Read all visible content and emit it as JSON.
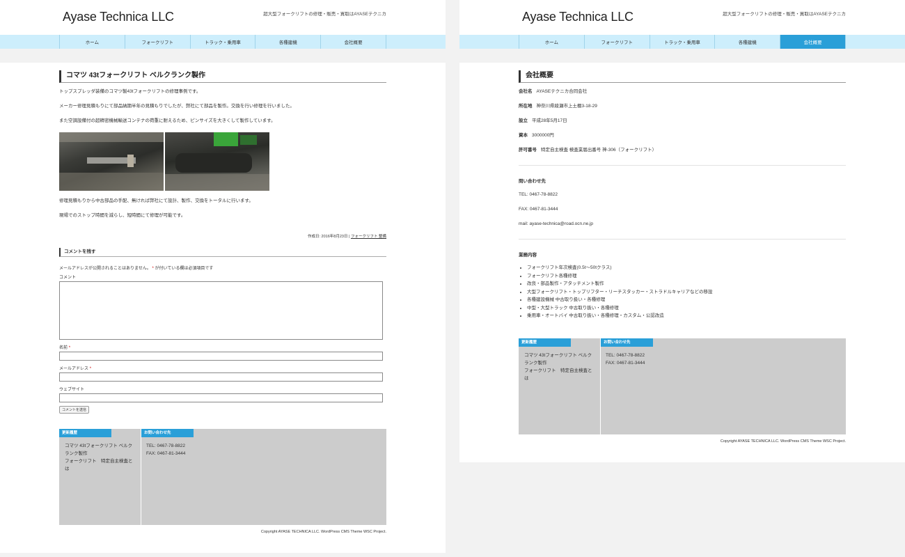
{
  "site": {
    "title": "Ayase Technica LLC",
    "tagline": "超大型フォークリフトの修理・販売・買取はAYASEテクニカ"
  },
  "nav": [
    "ホーム",
    "フォークリフト",
    "トラック・乗用車",
    "各種建機",
    "会社概要"
  ],
  "post": {
    "title": "コマツ 43tフォークリフト ベルクランク製作",
    "p1": "トップスプレッダ装備のコマツ製43tフォークリフトの修理事例です。",
    "p2": "メーカー修理見積もりにて部品納期半年の見積もりでしたが、弊社にて部品を製作。交換を行い修理を行いました。",
    "p3": "また空調設備付の超精密機械輸送コンテナの荷重に耐えるため、ピンサイズを大きくして製作しています。",
    "p4": "修理見積もりから中古部品の手配、無ければ弊社にて設計、製作、交換をトータルに行います。",
    "p5": "現場でのストップ時間を減らし、短時間にて修理が可能です。",
    "meta_prefix": "作成日: 2016年8月23日 |",
    "meta_link": "フォークリフト 整備"
  },
  "comment_form": {
    "heading": "コメントを残す",
    "notice_before": "メールアドレスが公開されることはありません。",
    "notice_star": "*",
    "notice_after": " が付いている欄は必須項目です",
    "comment_label": "コメント",
    "name_label": "名前",
    "email_label": "メールアドレス",
    "website_label": "ウェブサイト",
    "required_mark": "*",
    "submit": "コメントを送信"
  },
  "footer": {
    "updates_tab": "更新履歴",
    "updates": [
      "コマツ 43tフォークリフト ベルク",
      "ランク製作",
      "フォークリフト　特定自主検査と",
      "は"
    ],
    "contact_tab": "お問い合わせ先",
    "tel": "TEL: 0467-78-8822",
    "fax": "FAX: 0467-81-3444",
    "copyright": "Copyright AYASE TECHNICA LLC. WordPress CMS Theme WSC Project."
  },
  "company": {
    "title": "会社概要",
    "rows": [
      {
        "label": "会社名",
        "value": "AYASEテクニカ合同会社"
      },
      {
        "label": "所在地",
        "value": "神奈川県綾瀬市上土棚3-18-29"
      },
      {
        "label": "設立",
        "value": "平成28年5月17日"
      },
      {
        "label": "資本",
        "value": "3000000円"
      },
      {
        "label": "許可番号",
        "value": "特定自主検査 検査業届出番号 神-306（フォークリフト）"
      }
    ],
    "contact_heading": "問い合わせ先",
    "tel": "TEL: 0467-78-8822",
    "fax": "FAX: 0467-81-3444",
    "mail": "mail: ayase-technica@road.ocn.ne.jp",
    "services_heading": "業務内容",
    "services": [
      "フォークリフト年次検査(0.5t〜50tクラス)",
      "フォークリフト各種修理",
      "改良・部品製作・アタッチメント製作",
      "大型フォークリフト・トップリフター・リーチスタッカー・ストラドルキャリアなどの移設",
      "各種建設機械 中古取り扱い・各種修理",
      "中型・大型トラック 中古取り扱い・各種修理",
      "乗用車・オートバイ 中古取り扱い・各種修理・カスタム・公認改造"
    ]
  }
}
